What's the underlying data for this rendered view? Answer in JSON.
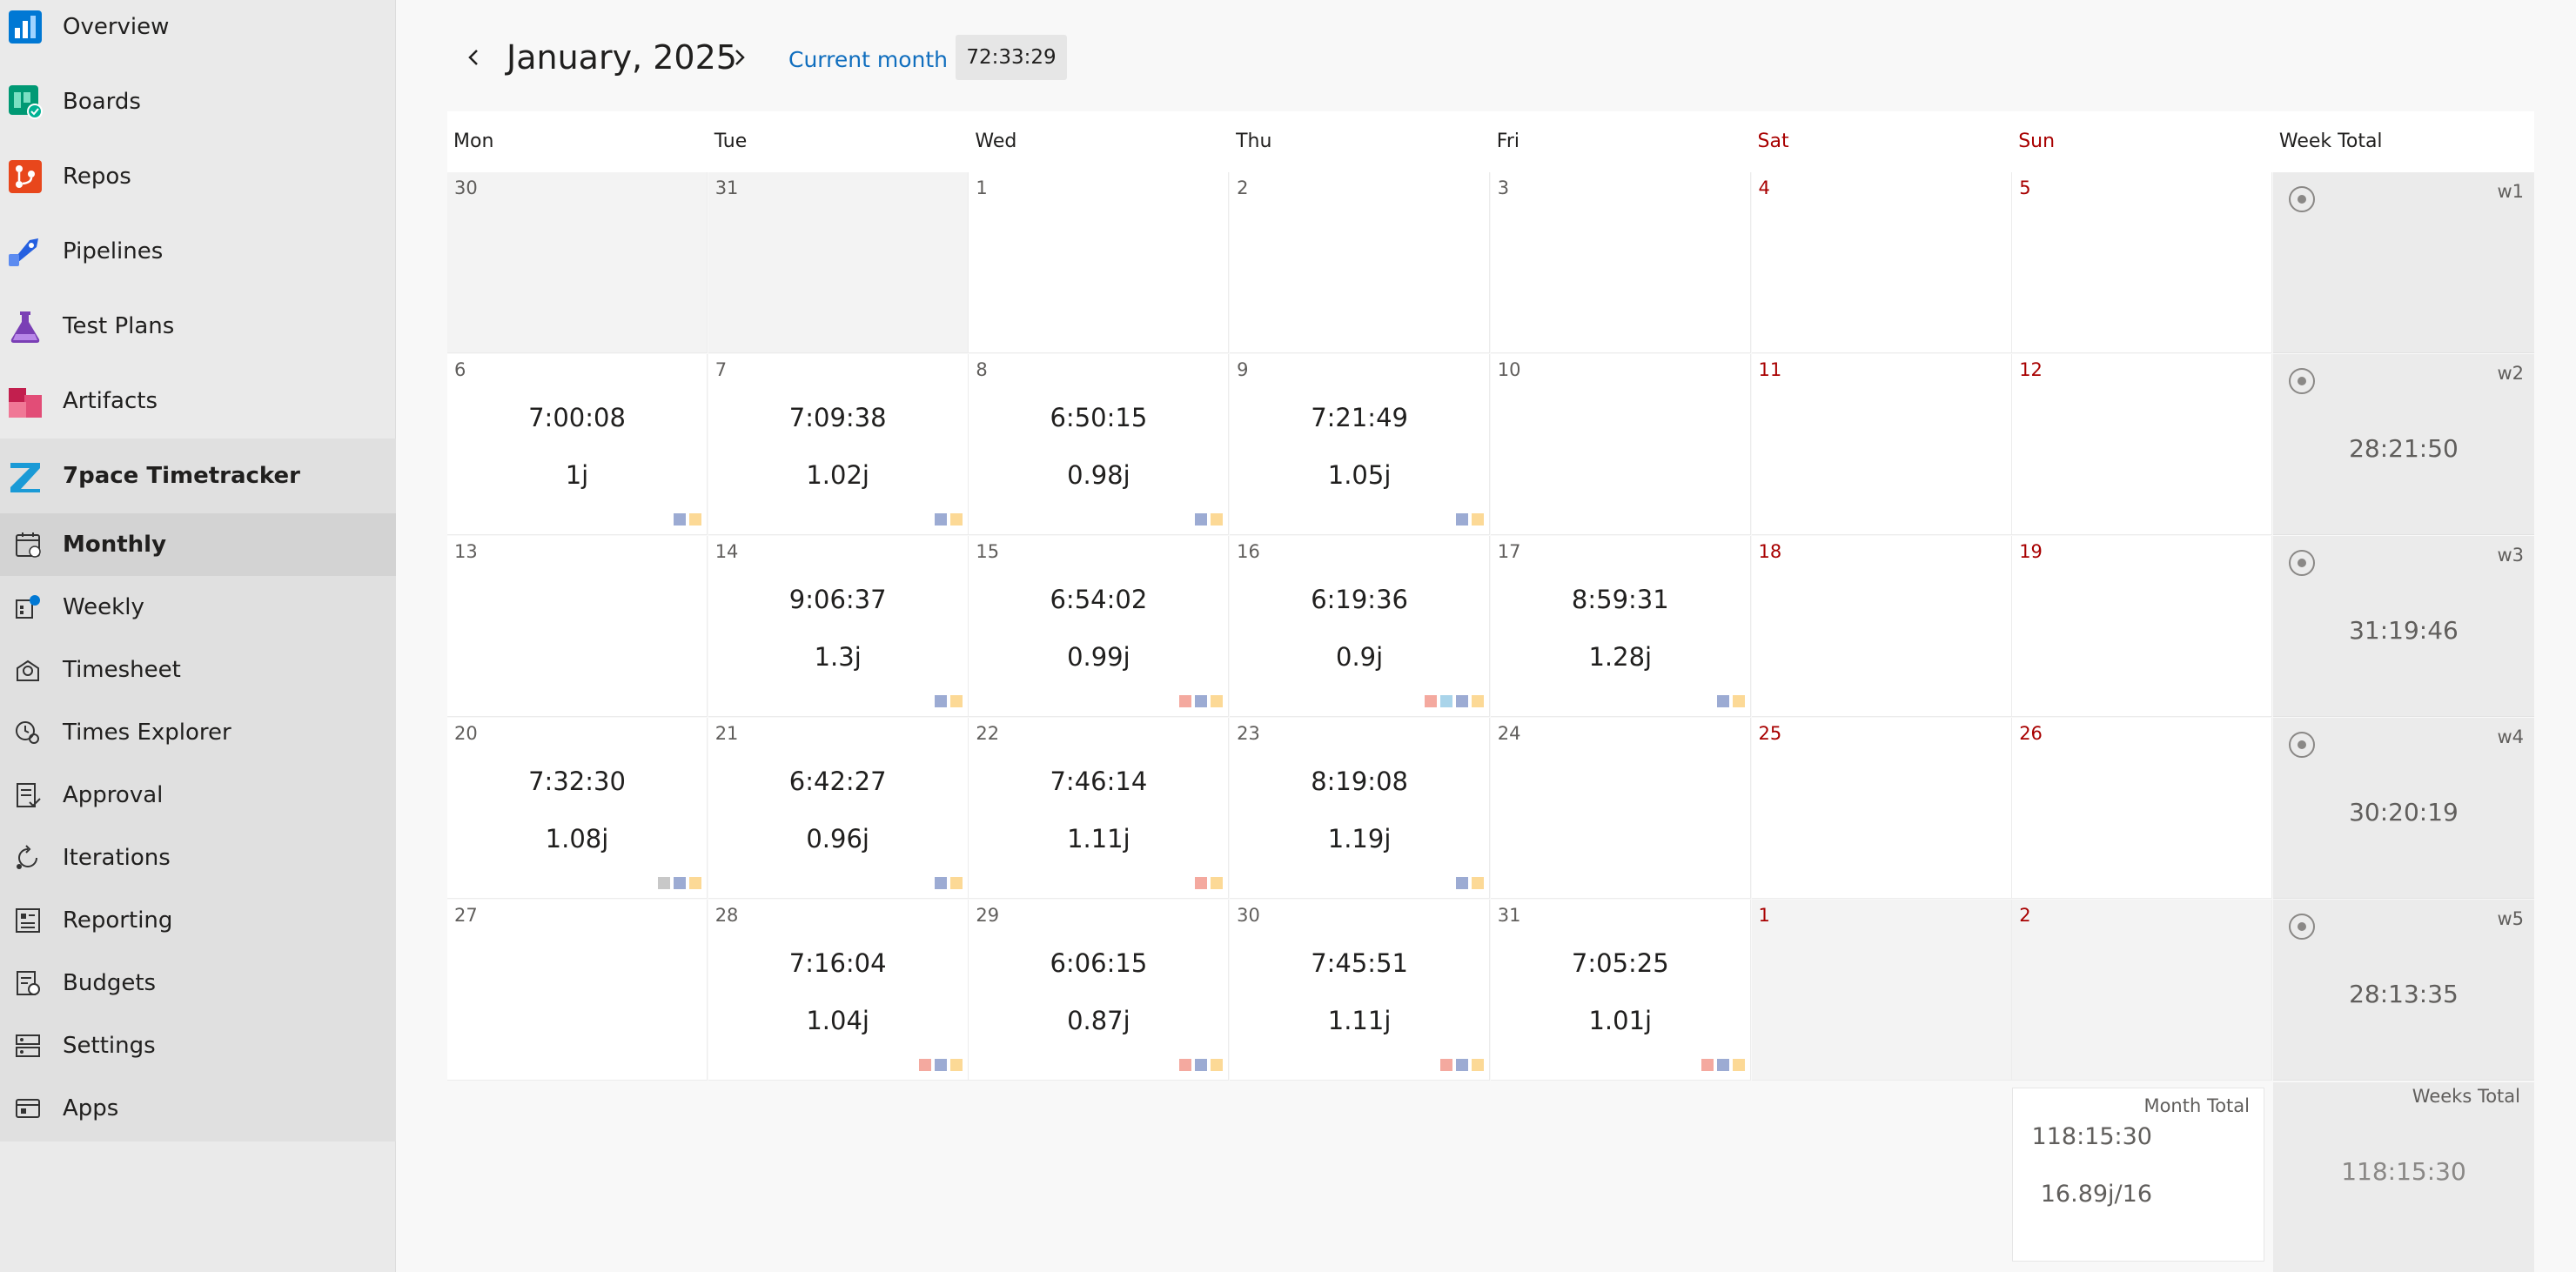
{
  "sidebar": {
    "nav": [
      {
        "label": "Overview",
        "icon": "overview-icon"
      },
      {
        "label": "Boards",
        "icon": "boards-icon"
      },
      {
        "label": "Repos",
        "icon": "repos-icon"
      },
      {
        "label": "Pipelines",
        "icon": "pipelines-icon"
      },
      {
        "label": "Test Plans",
        "icon": "test-plans-icon"
      },
      {
        "label": "Artifacts",
        "icon": "artifacts-icon"
      },
      {
        "label": "7pace Timetracker",
        "icon": "timetracker-icon"
      }
    ],
    "sub": [
      {
        "label": "Monthly",
        "icon": "calendar-icon",
        "selected": true
      },
      {
        "label": "Weekly",
        "icon": "weekly-icon"
      },
      {
        "label": "Timesheet",
        "icon": "timesheet-icon"
      },
      {
        "label": "Times Explorer",
        "icon": "times-explorer-icon"
      },
      {
        "label": "Approval",
        "icon": "approval-icon"
      },
      {
        "label": "Iterations",
        "icon": "iterations-icon"
      },
      {
        "label": "Reporting",
        "icon": "reporting-icon"
      },
      {
        "label": "Budgets",
        "icon": "budgets-icon"
      },
      {
        "label": "Settings",
        "icon": "settings-icon"
      },
      {
        "label": "Apps",
        "icon": "apps-icon"
      }
    ]
  },
  "header": {
    "month": "January, 2025",
    "current_month_label": "Current month",
    "timer": "72:33:29"
  },
  "colors": {
    "weekend": "#a80000",
    "link": "#106ebe",
    "tag_red": "#f4a99f",
    "tag_blue": "#9cabd3",
    "tag_yellow": "#fcd996",
    "tag_lightblue": "#a9d4ea",
    "tag_gray": "#c8c8c8"
  },
  "calendar": {
    "headers": [
      "Mon",
      "Tue",
      "Wed",
      "Thu",
      "Fri",
      "Sat",
      "Sun",
      "Week Total"
    ],
    "weeks": [
      {
        "label": "w1",
        "total": "",
        "days": [
          {
            "d": "30",
            "other": true
          },
          {
            "d": "31",
            "other": true
          },
          {
            "d": "1"
          },
          {
            "d": "2"
          },
          {
            "d": "3"
          },
          {
            "d": "4"
          },
          {
            "d": "5"
          }
        ]
      },
      {
        "label": "w2",
        "total": "28:21:50",
        "days": [
          {
            "d": "6",
            "time": "7:00:08",
            "units": "1j",
            "tags": [
              "blue",
              "yellow"
            ]
          },
          {
            "d": "7",
            "time": "7:09:38",
            "units": "1.02j",
            "tags": [
              "blue",
              "yellow"
            ]
          },
          {
            "d": "8",
            "time": "6:50:15",
            "units": "0.98j",
            "tags": [
              "blue",
              "yellow"
            ]
          },
          {
            "d": "9",
            "time": "7:21:49",
            "units": "1.05j",
            "tags": [
              "blue",
              "yellow"
            ]
          },
          {
            "d": "10"
          },
          {
            "d": "11"
          },
          {
            "d": "12"
          }
        ]
      },
      {
        "label": "w3",
        "total": "31:19:46",
        "days": [
          {
            "d": "13"
          },
          {
            "d": "14",
            "time": "9:06:37",
            "units": "1.3j",
            "tags": [
              "blue",
              "yellow"
            ]
          },
          {
            "d": "15",
            "time": "6:54:02",
            "units": "0.99j",
            "tags": [
              "red",
              "blue",
              "yellow"
            ]
          },
          {
            "d": "16",
            "time": "6:19:36",
            "units": "0.9j",
            "tags": [
              "red",
              "lightblue",
              "blue",
              "yellow"
            ]
          },
          {
            "d": "17",
            "time": "8:59:31",
            "units": "1.28j",
            "tags": [
              "blue",
              "yellow"
            ]
          },
          {
            "d": "18"
          },
          {
            "d": "19"
          }
        ]
      },
      {
        "label": "w4",
        "total": "30:20:19",
        "days": [
          {
            "d": "20",
            "time": "7:32:30",
            "units": "1.08j",
            "tags": [
              "gray",
              "blue",
              "yellow"
            ]
          },
          {
            "d": "21",
            "time": "6:42:27",
            "units": "0.96j",
            "tags": [
              "blue",
              "yellow"
            ]
          },
          {
            "d": "22",
            "time": "7:46:14",
            "units": "1.11j",
            "tags": [
              "red",
              "yellow"
            ]
          },
          {
            "d": "23",
            "time": "8:19:08",
            "units": "1.19j",
            "tags": [
              "blue",
              "yellow"
            ]
          },
          {
            "d": "24"
          },
          {
            "d": "25"
          },
          {
            "d": "26"
          }
        ]
      },
      {
        "label": "w5",
        "total": "28:13:35",
        "days": [
          {
            "d": "27"
          },
          {
            "d": "28",
            "time": "7:16:04",
            "units": "1.04j",
            "tags": [
              "red",
              "blue",
              "yellow"
            ]
          },
          {
            "d": "29",
            "time": "6:06:15",
            "units": "0.87j",
            "tags": [
              "red",
              "blue",
              "yellow"
            ]
          },
          {
            "d": "30",
            "time": "7:45:51",
            "units": "1.11j",
            "tags": [
              "red",
              "blue",
              "yellow"
            ]
          },
          {
            "d": "31",
            "time": "7:05:25",
            "units": "1.01j",
            "tags": [
              "red",
              "blue",
              "yellow"
            ]
          },
          {
            "d": "1",
            "other": true
          },
          {
            "d": "2",
            "other": true
          }
        ]
      }
    ]
  },
  "totals": {
    "month_label": "Month Total",
    "month_time": "118:15:30",
    "month_units": "16.89j/16",
    "weeks_label": "Weeks Total",
    "weeks_time": "118:15:30"
  }
}
